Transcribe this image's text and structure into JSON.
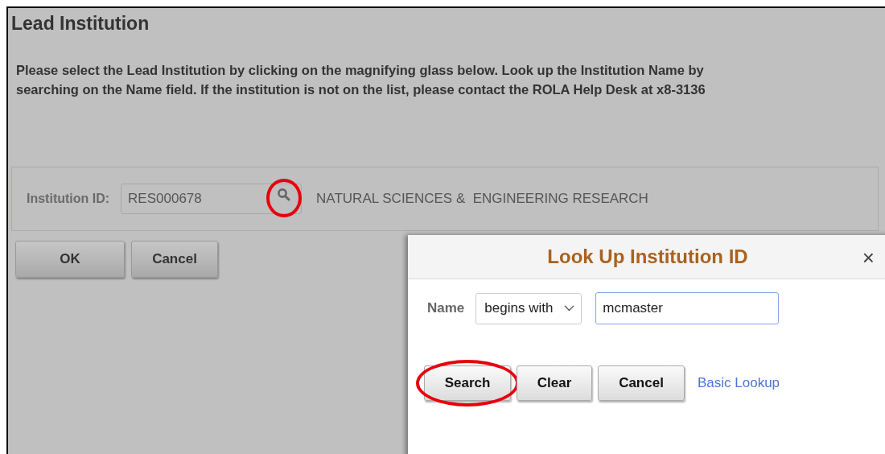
{
  "page": {
    "title": "Lead Institution",
    "instructions": "Please select the Lead Institution by clicking on the magnifying glass below. Look up the Institution Name by searching on the Name field. If the institution is not on the list, please contact the ROLA Help Desk at x8-3136",
    "field": {
      "label": "Institution ID:",
      "value": "RES000678",
      "lookup_circled": true,
      "description": "NATURAL SCIENCES &  ENGINEERING RESEARCH"
    },
    "buttons": [
      "OK",
      "Cancel"
    ]
  },
  "dialog": {
    "title": "Look Up Institution ID",
    "close": "×",
    "criteria": {
      "label": "Name",
      "operator": "begins with",
      "value": "mcmaster"
    },
    "buttons": [
      {
        "label": "Search",
        "circled": true
      },
      {
        "label": "Clear",
        "circled": false
      },
      {
        "label": "Cancel",
        "circled": false
      }
    ],
    "link": "Basic Lookup"
  }
}
